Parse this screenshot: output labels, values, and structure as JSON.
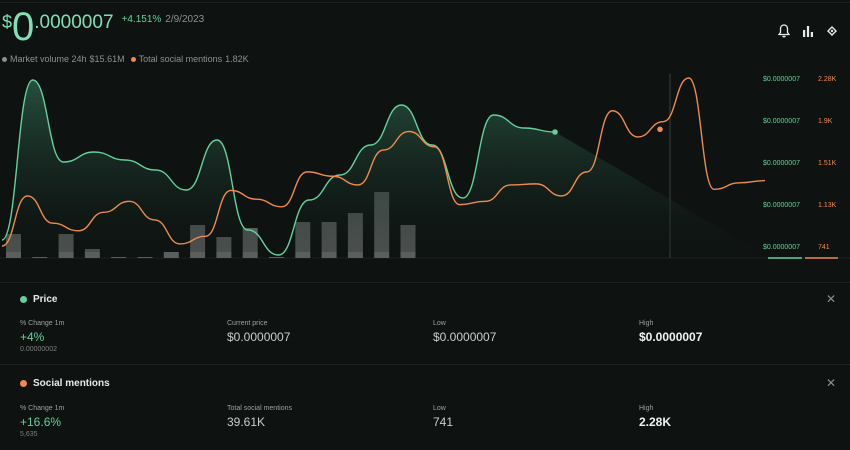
{
  "header": {
    "currency_symbol": "$",
    "price_whole": "0",
    "price_decimals": ".0000007",
    "change": "+4.151%",
    "date": "2/9/2023",
    "legend": [
      {
        "label": "Market volume 24h",
        "value": "$15.61M",
        "color": "#8b918f"
      },
      {
        "label": "Total social mentions",
        "value": "1.82K",
        "color": "#f08a4b"
      }
    ],
    "icons": [
      "bell-icon",
      "bar-chart-icon",
      "share-icon"
    ]
  },
  "chart_data": {
    "type": "line",
    "x": [
      0,
      1,
      2,
      3,
      4,
      5,
      6,
      7,
      8,
      9,
      10,
      11,
      12,
      13,
      14,
      15,
      16,
      17,
      18,
      19,
      20,
      21,
      22,
      23,
      24,
      25,
      26,
      27,
      28,
      29,
      30
    ],
    "series": [
      {
        "name": "Price",
        "color": "#62d19a",
        "values": [
          7e-07,
          7e-07,
          7e-07,
          7e-07,
          7e-07,
          7e-07,
          7e-07,
          7e-07,
          7e-07,
          7e-07,
          7e-07,
          7e-07,
          7e-07,
          7e-07,
          7e-07,
          7e-07,
          7e-07,
          7e-07,
          7e-07,
          7e-07,
          7e-07,
          7e-07,
          7e-07,
          7e-07,
          7e-07,
          7e-07,
          7e-07,
          7e-07,
          7e-07,
          7e-07,
          7e-07
        ]
      },
      {
        "name": "Social mentions",
        "color": "#f08a4b",
        "values": [
          741,
          1200,
          950,
          880,
          1050,
          1150,
          980,
          760,
          830,
          1250,
          1170,
          1100,
          1420,
          1380,
          1300,
          1620,
          1790,
          1650,
          1120,
          1150,
          1300,
          1310,
          1200,
          1420,
          1980,
          1740,
          1880,
          2280,
          1260,
          1320,
          1340
        ]
      }
    ],
    "volume_bars": [
      0.08,
      0.0,
      0.08,
      0.03,
      0.0,
      0.0,
      0.02,
      0.11,
      0.07,
      0.1,
      0.0,
      0.12,
      0.12,
      0.15,
      0.22,
      0.11
    ],
    "left_ticks": [
      "$0.0000007",
      "$0.0000007",
      "$0.0000007",
      "$0.0000007",
      "$0.0000007"
    ],
    "right_ticks": [
      "2.28K",
      "1.9K",
      "1.51K",
      "1.13K",
      "741"
    ]
  },
  "panels": [
    {
      "title": "Price",
      "color": "#62d19a",
      "stats": [
        {
          "label": "% Change 1m",
          "value": "+4%",
          "sub": "0.00000002",
          "style": "green"
        },
        {
          "label": "Current price",
          "value": "$0.0000007",
          "sub": "",
          "style": ""
        },
        {
          "label": "Low",
          "value": "$0.0000007",
          "sub": "",
          "style": ""
        },
        {
          "label": "High",
          "value": "$0.0000007",
          "sub": "",
          "style": "bold"
        }
      ]
    },
    {
      "title": "Social mentions",
      "color": "#f08a4b",
      "stats": [
        {
          "label": "% Change 1m",
          "value": "+16.6%",
          "sub": "5,635",
          "style": "green"
        },
        {
          "label": "Total social mentions",
          "value": "39.61K",
          "sub": "",
          "style": ""
        },
        {
          "label": "Low",
          "value": "741",
          "sub": "",
          "style": ""
        },
        {
          "label": "High",
          "value": "2.28K",
          "sub": "",
          "style": "bold"
        }
      ]
    }
  ],
  "close_symbol": "✕"
}
